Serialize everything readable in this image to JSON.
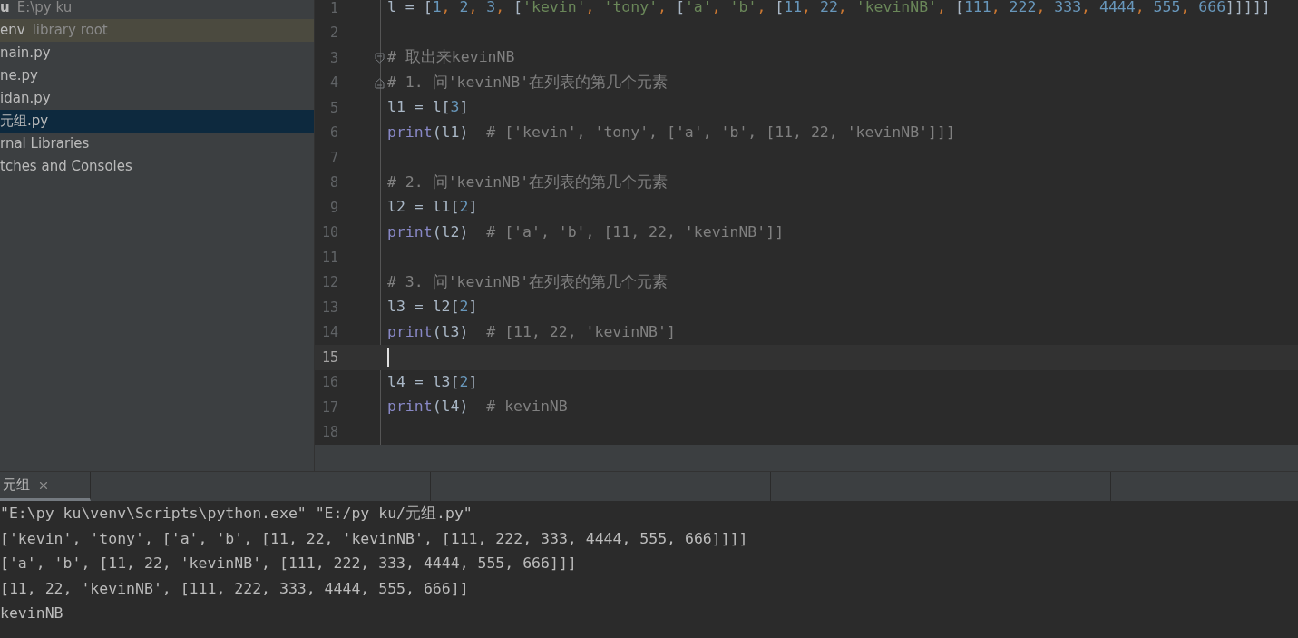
{
  "project_tree": {
    "items": [
      {
        "name": "u",
        "hint": "E:\\py ku",
        "kind": "root",
        "selected": false
      },
      {
        "name": "env",
        "hint": "library root",
        "kind": "library",
        "selected": false
      },
      {
        "name": "nain.py",
        "kind": "file",
        "selected": false
      },
      {
        "name": "ne.py",
        "kind": "file",
        "selected": false
      },
      {
        "name": "idan.py",
        "kind": "file",
        "selected": false
      },
      {
        "name": "元组.py",
        "kind": "file",
        "selected": true
      },
      {
        "name": "rnal Libraries",
        "kind": "file",
        "selected": false
      },
      {
        "name": "tches and Consoles",
        "kind": "file",
        "selected": false
      }
    ]
  },
  "editor": {
    "lines": [
      {
        "number": "1",
        "current": false,
        "kind": "code",
        "tokens": [
          {
            "kind": "id",
            "text": "l = ["
          },
          {
            "kind": "num",
            "text": "1"
          },
          {
            "kind": "punct",
            "text": ", "
          },
          {
            "kind": "num",
            "text": "2"
          },
          {
            "kind": "punct",
            "text": ", "
          },
          {
            "kind": "num",
            "text": "3"
          },
          {
            "kind": "punct",
            "text": ", "
          },
          {
            "kind": "id",
            "text": "["
          },
          {
            "kind": "str",
            "text": "'kevin'"
          },
          {
            "kind": "punct",
            "text": ", "
          },
          {
            "kind": "str",
            "text": "'tony'"
          },
          {
            "kind": "punct",
            "text": ", "
          },
          {
            "kind": "id",
            "text": "["
          },
          {
            "kind": "str",
            "text": "'a'"
          },
          {
            "kind": "punct",
            "text": ", "
          },
          {
            "kind": "str",
            "text": "'b'"
          },
          {
            "kind": "punct",
            "text": ", "
          },
          {
            "kind": "id",
            "text": "["
          },
          {
            "kind": "num",
            "text": "11"
          },
          {
            "kind": "punct",
            "text": ", "
          },
          {
            "kind": "num",
            "text": "22"
          },
          {
            "kind": "punct",
            "text": ", "
          },
          {
            "kind": "str",
            "text": "'kevinNB'"
          },
          {
            "kind": "punct",
            "text": ", "
          },
          {
            "kind": "id",
            "text": "["
          },
          {
            "kind": "num",
            "text": "111"
          },
          {
            "kind": "punct",
            "text": ", "
          },
          {
            "kind": "num",
            "text": "222"
          },
          {
            "kind": "punct",
            "text": ", "
          },
          {
            "kind": "num",
            "text": "333"
          },
          {
            "kind": "punct",
            "text": ", "
          },
          {
            "kind": "num",
            "text": "4444"
          },
          {
            "kind": "punct",
            "text": ", "
          },
          {
            "kind": "num",
            "text": "555"
          },
          {
            "kind": "punct",
            "text": ", "
          },
          {
            "kind": "num",
            "text": "666"
          },
          {
            "kind": "id",
            "text": "]]]]]"
          }
        ]
      },
      {
        "number": "2",
        "current": false,
        "kind": "code"
      },
      {
        "number": "3",
        "current": false,
        "kind": "fold_start",
        "tokens": [
          {
            "kind": "comment",
            "text": "# 取出来kevinNB"
          }
        ]
      },
      {
        "number": "4",
        "current": false,
        "kind": "fold_end",
        "tokens": [
          {
            "kind": "comment",
            "text": "# 1. 问'kevinNB'在列表的第几个元素"
          }
        ]
      },
      {
        "number": "5",
        "current": false,
        "kind": "code",
        "tokens": [
          {
            "kind": "id",
            "text": "l1 = l["
          },
          {
            "kind": "num",
            "text": "3"
          },
          {
            "kind": "id",
            "text": "]"
          }
        ]
      },
      {
        "number": "6",
        "current": false,
        "kind": "code",
        "tokens": [
          {
            "kind": "kw",
            "text": "print"
          },
          {
            "kind": "id",
            "text": "(l1)  "
          },
          {
            "kind": "comment",
            "text": "# ['kevin', 'tony', ['a', 'b', [11, 22, 'kevinNB']]]"
          }
        ]
      },
      {
        "number": "7",
        "current": false,
        "kind": "code"
      },
      {
        "number": "8",
        "current": false,
        "kind": "code",
        "tokens": [
          {
            "kind": "comment",
            "text": "# 2. 问'kevinNB'在列表的第几个元素"
          }
        ]
      },
      {
        "number": "9",
        "current": false,
        "kind": "code",
        "tokens": [
          {
            "kind": "id",
            "text": "l2 = l1["
          },
          {
            "kind": "num",
            "text": "2"
          },
          {
            "kind": "id",
            "text": "]"
          }
        ]
      },
      {
        "number": "10",
        "current": false,
        "kind": "code",
        "tokens": [
          {
            "kind": "kw",
            "text": "print"
          },
          {
            "kind": "id",
            "text": "(l2)  "
          },
          {
            "kind": "comment",
            "text": "# ['a', 'b', [11, 22, 'kevinNB']]"
          }
        ]
      },
      {
        "number": "11",
        "current": false,
        "kind": "code"
      },
      {
        "number": "12",
        "current": false,
        "kind": "code",
        "tokens": [
          {
            "kind": "comment",
            "text": "# 3. 问'kevinNB'在列表的第几个元素"
          }
        ]
      },
      {
        "number": "13",
        "current": false,
        "kind": "code",
        "tokens": [
          {
            "kind": "id",
            "text": "l3 = l2["
          },
          {
            "kind": "num",
            "text": "2"
          },
          {
            "kind": "id",
            "text": "]"
          }
        ]
      },
      {
        "number": "14",
        "current": false,
        "kind": "code",
        "tokens": [
          {
            "kind": "kw",
            "text": "print"
          },
          {
            "kind": "id",
            "text": "(l3)  "
          },
          {
            "kind": "comment",
            "text": "# [11, 22, 'kevinNB']"
          }
        ]
      },
      {
        "number": "15",
        "current": true,
        "kind": "code"
      },
      {
        "number": "16",
        "current": false,
        "kind": "code",
        "tokens": [
          {
            "kind": "id",
            "text": "l4 = l3["
          },
          {
            "kind": "num",
            "text": "2"
          },
          {
            "kind": "id",
            "text": "]"
          }
        ]
      },
      {
        "number": "17",
        "current": false,
        "kind": "code",
        "tokens": [
          {
            "kind": "kw",
            "text": "print"
          },
          {
            "kind": "id",
            "text": "(l4)  "
          },
          {
            "kind": "comment",
            "text": "# kevinNB"
          }
        ]
      },
      {
        "number": "18",
        "current": false,
        "kind": "code"
      }
    ]
  },
  "run_panel": {
    "tabs": [
      {
        "label": "元组",
        "selected": true
      }
    ],
    "output": [
      "\"E:\\py ku\\venv\\Scripts\\python.exe\" \"E:/py ku/元组.py\"",
      "['kevin', 'tony', ['a', 'b', [11, 22, 'kevinNB', [111, 222, 333, 4444, 555, 666]]]]",
      "['a', 'b', [11, 22, 'kevinNB', [111, 222, 333, 4444, 555, 666]]]",
      "[11, 22, 'kevinNB', [111, 222, 333, 4444, 555, 666]]",
      "kevinNB"
    ]
  }
}
